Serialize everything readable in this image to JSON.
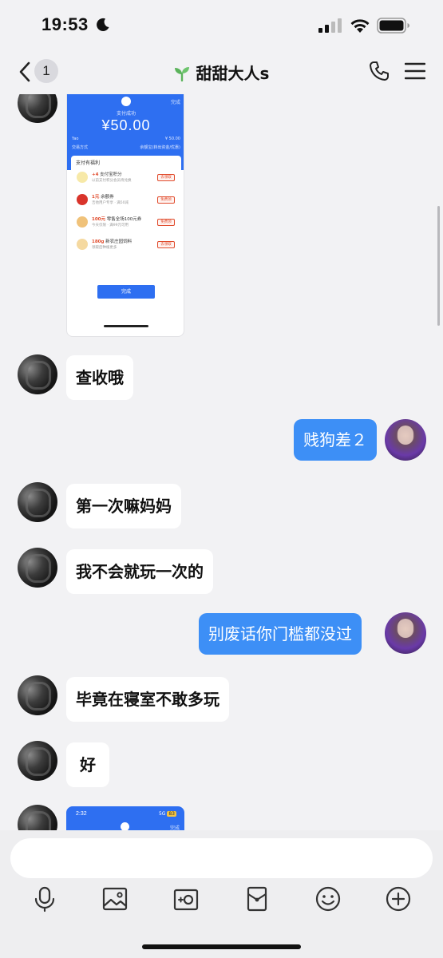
{
  "status_bar": {
    "time": "19:53",
    "focus_icon": "moon-icon",
    "signal_icon": "cellular-signal-icon",
    "wifi_icon": "wifi-icon",
    "battery_icon": "battery-icon"
  },
  "nav": {
    "back_icon": "chevron-left-icon",
    "unread_count": "1",
    "title": "甜甜大人s",
    "title_icon": "sprout-icon",
    "call_icon": "phone-icon",
    "menu_icon": "hamburger-menu-icon"
  },
  "receipt_image": {
    "done_top": "完成",
    "success": "支付成功",
    "amount": "¥50.00",
    "row1_left": "Yao",
    "row1_right": "¥ 50.00",
    "row2_left": "交易方式",
    "row2_right": "余额宝(转出资金/优惠)",
    "panel_title": "支付有福利",
    "perks": [
      {
        "main_em": "+4",
        "main": " 支付宝积分",
        "sub": "以前支付积分会员待兑换",
        "btn": "去领取"
      },
      {
        "main_em": "1元",
        "main": " 余额券",
        "sub": "吉他用户专享 · 满50减",
        "btn": "免费领"
      },
      {
        "main_em": "100元",
        "main": " 零售全场100元券",
        "sub": "今天仅限 · 满99元可用",
        "btn": "免费领"
      },
      {
        "main_em": "180g",
        "main": " 新农庄园饲料",
        "sub": "领取后种植更多",
        "btn": "去领取"
      }
    ],
    "finish": "完成"
  },
  "receipt_image_2": {
    "time": "2:32",
    "signal": "5G",
    "badge": "83",
    "done": "完成"
  },
  "messages": [
    {
      "side": "left",
      "text": "查收哦"
    },
    {
      "side": "right",
      "text": "贱狗差２"
    },
    {
      "side": "left",
      "text": "第一次嘛妈妈"
    },
    {
      "side": "left",
      "text": "我不会就玩一次的"
    },
    {
      "side": "right",
      "text": "别废话你门槛都没过"
    },
    {
      "side": "left",
      "text": "毕竟在寝室不敢多玩"
    },
    {
      "side": "left",
      "text": "好"
    }
  ],
  "input": {
    "placeholder": ""
  },
  "toolbar": [
    "microphone-icon",
    "image-icon",
    "camera-icon",
    "red-packet-icon",
    "emoji-icon",
    "plus-icon"
  ],
  "colors": {
    "accent": "#3d8ff6",
    "background": "#f2f2f4",
    "receipt_blue": "#2e6ff1"
  }
}
